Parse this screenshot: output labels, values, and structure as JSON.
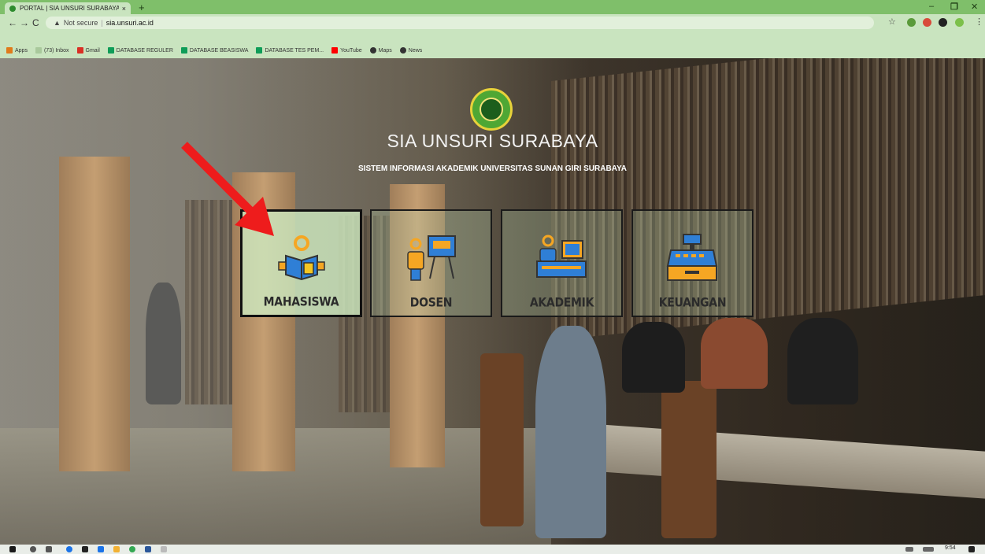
{
  "browser": {
    "tab_title": "PORTAL | SIA UNSURI SURABAYA",
    "tab_close": "×",
    "new_tab": "+",
    "security_text": "Not secure",
    "url": "sia.unsuri.ac.id",
    "bookmarks": [
      {
        "label": "Apps",
        "color": "#e07b1a"
      },
      {
        "label": "(73) Inbox",
        "color": "#c9e4bf"
      },
      {
        "label": "Gmail",
        "color": "#d93025"
      },
      {
        "label": "DATABASE REGULER",
        "color": "#0f9d58"
      },
      {
        "label": "DATABASE BEASISWA",
        "color": "#0f9d58"
      },
      {
        "label": "DATABASE TES PEM...",
        "color": "#0f9d58"
      },
      {
        "label": "YouTube",
        "color": "#ff0000"
      },
      {
        "label": "Maps",
        "color": "#333333"
      },
      {
        "label": "News",
        "color": "#333333"
      }
    ]
  },
  "page": {
    "title": "SIA UNSURI SURABAYA",
    "subtitle": "SISTEM INFORMASI AKADEMIK UNIVERSITAS SUNAN GIRI SURABAYA",
    "menu": [
      {
        "label": "MAHASISWA",
        "icon": "student-reading-icon",
        "active": true
      },
      {
        "label": "DOSEN",
        "icon": "lecturer-board-icon",
        "active": false
      },
      {
        "label": "AKADEMIK",
        "icon": "desk-computer-icon",
        "active": false
      },
      {
        "label": "KEUANGAN",
        "icon": "cash-register-icon",
        "active": false
      }
    ],
    "annotation_color": "#ee1c1c"
  },
  "taskbar": {
    "time": "9:54"
  }
}
